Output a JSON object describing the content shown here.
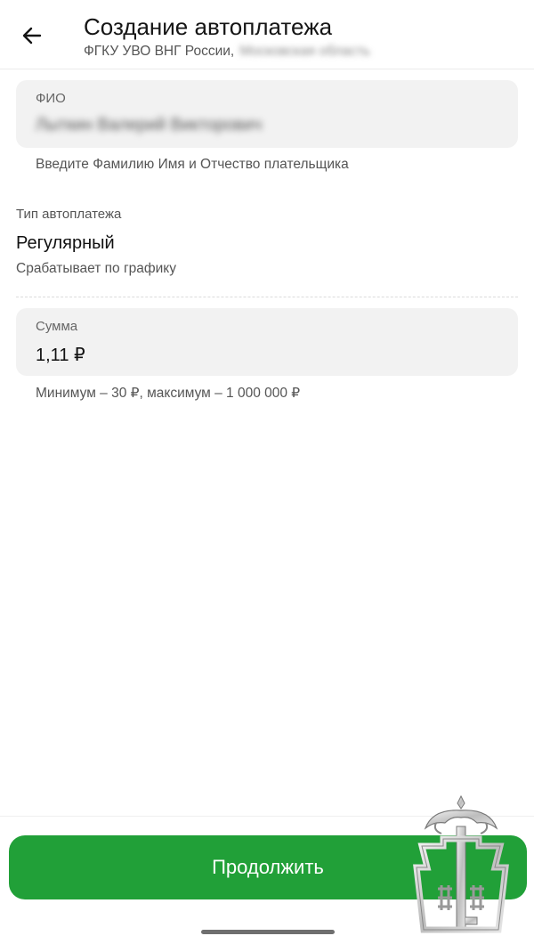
{
  "header": {
    "title": "Создание автоплатежа",
    "subtitle": "ФГКУ УВО ВНГ России,",
    "subtitle_blurred": "Московская область"
  },
  "fio": {
    "label": "ФИО",
    "value_blurred": "Лыткин Валерий Викторович",
    "hint": "Введите Фамилию Имя и Отчество плательщика"
  },
  "autopay_type": {
    "label": "Тип автоплатежа",
    "value": "Регулярный",
    "description": "Срабатывает по графику"
  },
  "amount": {
    "label": "Сумма",
    "value": "1,11 ₽",
    "hint": "Минимум – 30 ₽, максимум – 1 000 000 ₽"
  },
  "footer": {
    "continue_label": "Продолжить"
  },
  "icons": {
    "back": "arrow-left-icon",
    "emblem": "watermark-emblem-icon"
  },
  "colors": {
    "accent": "#21a038",
    "card_bg": "#f2f2f2"
  }
}
